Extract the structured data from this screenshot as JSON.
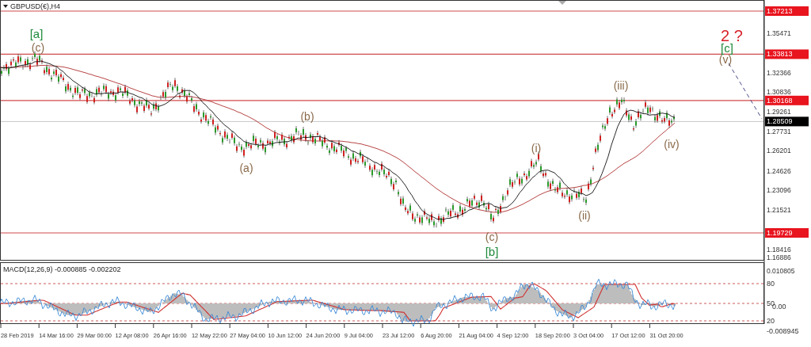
{
  "chart_title": "GBPUSD(€),H4",
  "price_axis": {
    "ticks": [
      "1.35471",
      "1.32366",
      "1.30836",
      "1.29261",
      "1.27731",
      "1.26201",
      "1.24626",
      "1.23096",
      "1.21521",
      "1.18416",
      "1.16886"
    ]
  },
  "levels": [
    {
      "label": "1.37213"
    },
    {
      "label": "1.33813"
    },
    {
      "label": "1.30168"
    },
    {
      "label": "1.19729"
    }
  ],
  "current_price": "1.28509",
  "wave_labels": [
    {
      "text": "2 ?",
      "kind": "target"
    },
    {
      "text": "[a]",
      "kind": "major"
    },
    {
      "text": "[c]",
      "kind": "major"
    },
    {
      "text": "(c)",
      "kind": "minor"
    },
    {
      "text": "(v)",
      "kind": "minor"
    },
    {
      "text": "(iii)",
      "kind": "minor"
    },
    {
      "text": "(b)",
      "kind": "minor"
    },
    {
      "text": "(iv)",
      "kind": "minor"
    },
    {
      "text": "(i)",
      "kind": "minor"
    },
    {
      "text": "(a)",
      "kind": "minor"
    },
    {
      "text": "(ii)",
      "kind": "minor"
    },
    {
      "text": "(c)",
      "kind": "minor"
    },
    {
      "text": "[b]",
      "kind": "major"
    }
  ],
  "macd": {
    "title": "MACD(12,26,9) -0.000885 -0.002202",
    "scale_max": "0.010805",
    "scale_zero": "0.00",
    "scale_min": "-0.008945",
    "levels": [
      "80",
      "50",
      "20"
    ]
  },
  "time_axis": [
    "28 Feb 2019",
    "14 Mar 16:00",
    "29 Mar 00:00",
    "12 Apr 08:00",
    "26 Apr 16:00",
    "12 May 22:00",
    "27 May 04:00",
    "10 Jun 12:00",
    "24 Jun 20:00",
    "9 Jul 04:00",
    "23 Jul 12:00",
    "6 Aug 20:00",
    "21 Aug 04:00",
    "4 Sep 12:00",
    "18 Sep 20:00",
    "3 Oct 04:00",
    "17 Oct 12:00",
    "31 Oct 20:00"
  ]
}
